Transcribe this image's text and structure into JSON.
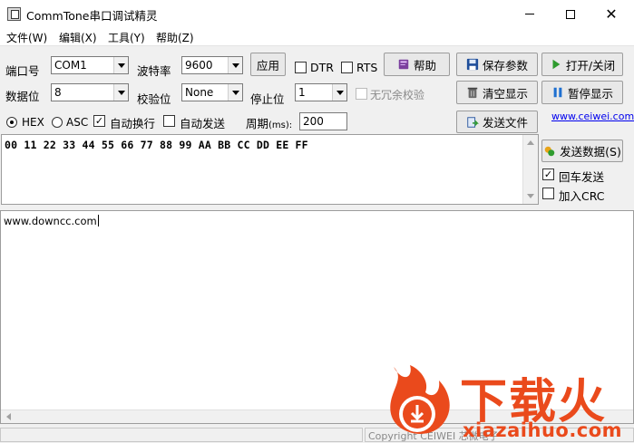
{
  "window": {
    "title": "CommTone串口调试精灵",
    "controls": {
      "minimize": "—",
      "maximize": "□",
      "close": "✕"
    }
  },
  "menu": {
    "file": "文件(W)",
    "edit": "编辑(X)",
    "tools": "工具(Y)",
    "help": "帮助(Z)"
  },
  "settings": {
    "port_label": "端口号",
    "port_value": "COM1",
    "baud_label": "波特率",
    "baud_value": "9600",
    "apply_label": "应用",
    "dtr_label": "DTR",
    "rts_label": "RTS",
    "help_label": "帮助",
    "save_label": "保存参数",
    "open_close_label": "打开/关闭",
    "databits_label": "数据位",
    "databits_value": "8",
    "parity_label": "校验位",
    "parity_value": "None",
    "stopbits_label": "停止位",
    "stopbits_value": "1",
    "no_parity_label": "无冗余校验",
    "clear_label": "清空显示",
    "pause_label": "暂停显示"
  },
  "send_options": {
    "hex_label": "HEX",
    "asc_label": "ASC",
    "auto_wrap_label": "自动换行",
    "auto_send_label": "自动发送",
    "period_label": "周期",
    "period_unit": "(ms):",
    "period_value": "200",
    "send_file_label": "发送文件",
    "website_link": "www.ceiwei.com"
  },
  "send_area": {
    "content": "00 11 22 33 44 55 66 77 88 99 AA BB CC DD EE FF"
  },
  "send_panel": {
    "send_data_label": "发送数据(S)",
    "echo_label": "回车发送",
    "crc_label": "加入CRC"
  },
  "receive_area": {
    "content": "www.downcc.com"
  },
  "statusbar": {
    "copyright": "Copyright CEIWEI 芯微电子"
  },
  "watermark": {
    "brand": "下载火",
    "domain": "xiazaihuo.com"
  },
  "colors": {
    "watermark": "#ea4a1c",
    "link": "#0000ee",
    "window_bg": "#f0f0f0"
  }
}
